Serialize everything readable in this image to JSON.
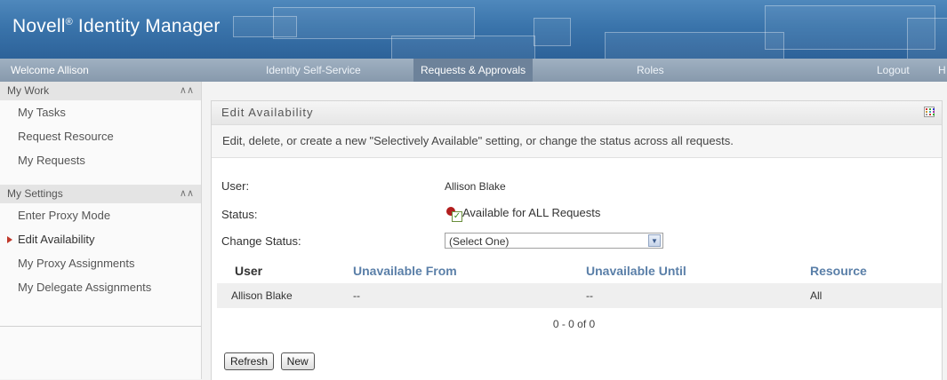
{
  "app": {
    "brand": "Novell",
    "brand_mark": "®",
    "brand_rest": "Identity Manager"
  },
  "nav": {
    "welcome": "Welcome Allison",
    "tabs": [
      {
        "label": "Identity Self-Service"
      },
      {
        "label": "Requests & Approvals"
      },
      {
        "label": "Roles"
      },
      {
        "label": "Logout"
      },
      {
        "label": "H"
      }
    ]
  },
  "sidebar": {
    "sections": [
      {
        "title": "My Work",
        "items": [
          "My Tasks",
          "Request Resource",
          "My Requests"
        ]
      },
      {
        "title": "My Settings",
        "items": [
          "Enter Proxy Mode",
          "Edit Availability",
          "My Proxy Assignments",
          "My Delegate Assignments"
        ]
      }
    ],
    "active_item": "Edit Availability"
  },
  "panel": {
    "title": "Edit Availability",
    "description": "Edit, delete, or create a new \"Selectively Available\" setting, or change the status across all requests.",
    "user_label": "User:",
    "user_value": "Allison Blake",
    "status_label": "Status:",
    "status_value": "Available for ALL Requests",
    "change_status_label": "Change Status:",
    "change_status_selected": "(Select One)",
    "table": {
      "headers": [
        "User",
        "Unavailable From",
        "Unavailable Until",
        "Resource"
      ],
      "rows": [
        [
          "Allison Blake",
          "--",
          "--",
          "All"
        ]
      ]
    },
    "pager": "0 - 0 of 0",
    "refresh_button": "Refresh",
    "new_button": "New"
  },
  "colors": {
    "header": "#3a74ab",
    "active_marker": "#c0392b",
    "column_header": "#5a7fa8"
  }
}
